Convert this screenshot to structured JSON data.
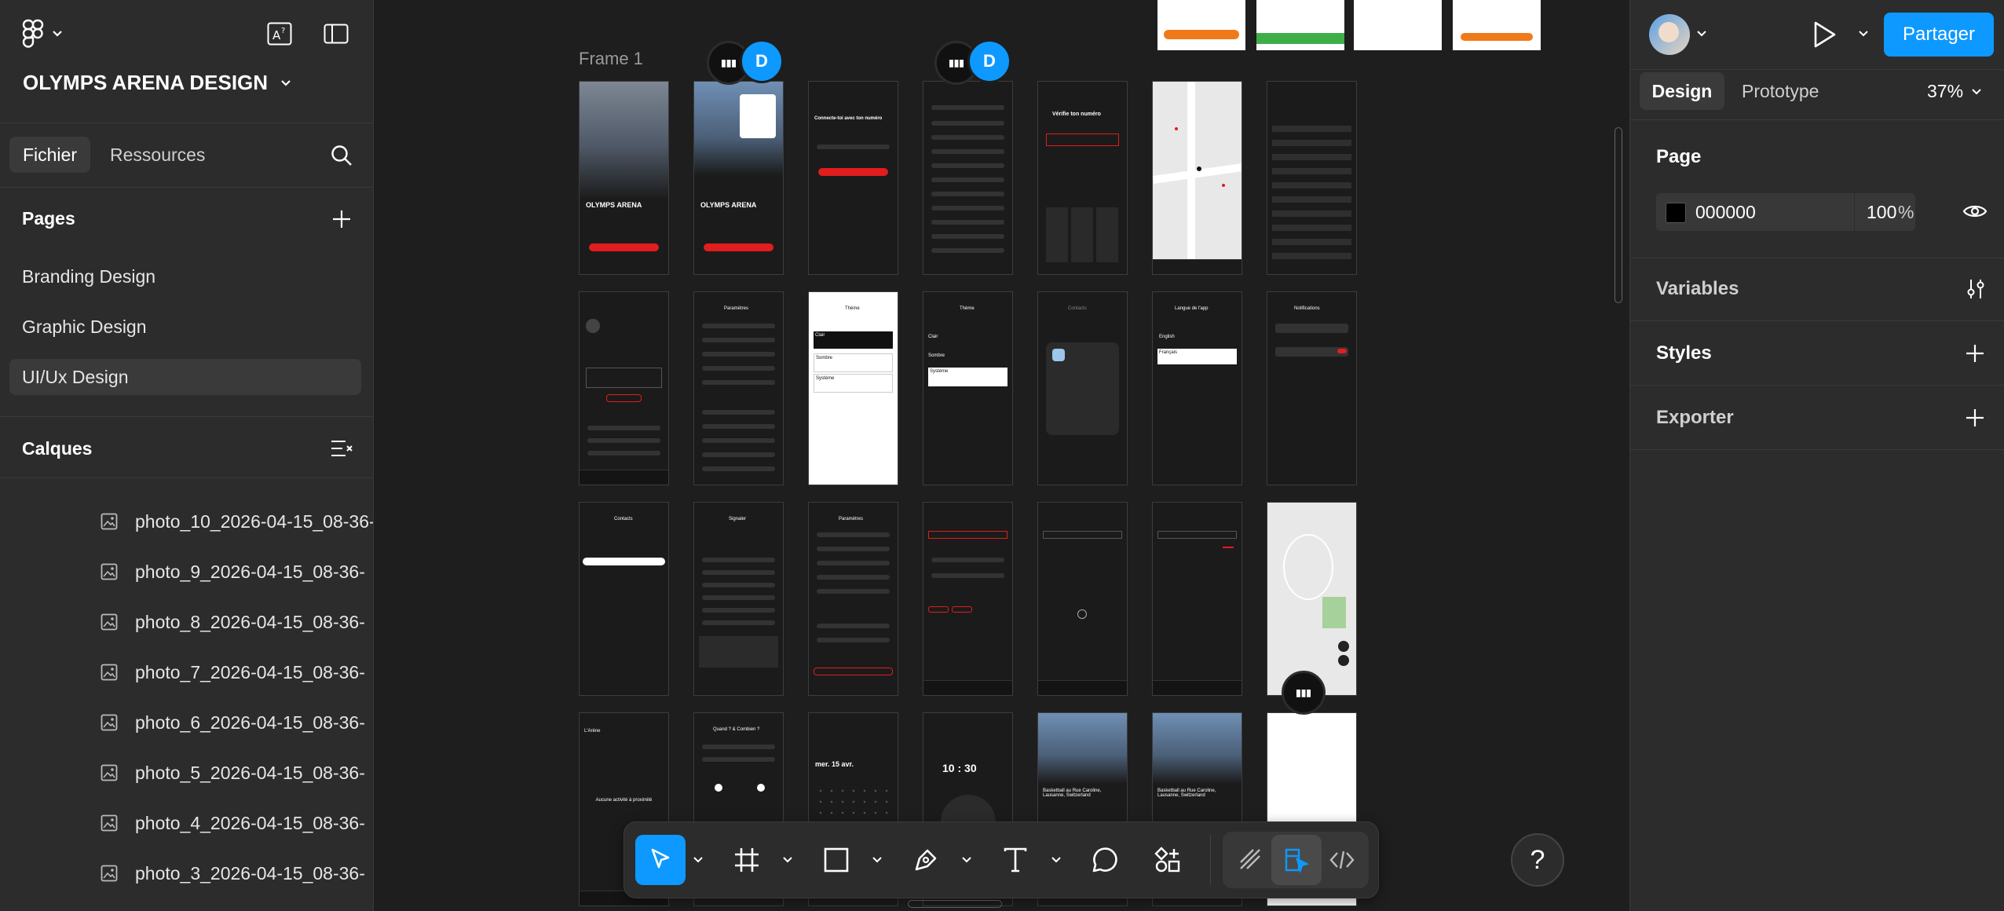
{
  "app": {
    "file_title": "OLYMPS ARENA DESIGN"
  },
  "left_panel": {
    "tabs": [
      {
        "label": "Fichier",
        "active": true
      },
      {
        "label": "Ressources",
        "active": false
      }
    ],
    "pages_title": "Pages",
    "pages": [
      {
        "label": "Branding Design",
        "active": false
      },
      {
        "label": "Graphic Design",
        "active": false
      },
      {
        "label": "UI/Ux Design",
        "active": true
      }
    ],
    "layers_title": "Calques",
    "layers": [
      "photo_10_2026-04-15_08-36-",
      "photo_9_2026-04-15_08-36-",
      "photo_8_2026-04-15_08-36-",
      "photo_7_2026-04-15_08-36-",
      "photo_6_2026-04-15_08-36-",
      "photo_5_2026-04-15_08-36-",
      "photo_4_2026-04-15_08-36-",
      "photo_3_2026-04-15_08-36-"
    ]
  },
  "canvas": {
    "frame_label": "Frame 1",
    "collaborator_initial": "D",
    "screen_texts": {
      "brand": "OLYMPS ARENA",
      "connect": "Connecte-toi avec ton numéro",
      "verify": "Vérifie ton numéro",
      "theme": "Thème",
      "parametres": "Paramètres",
      "contacts": "Contacts",
      "langue": "Langue de l'app",
      "notifications": "Notifications",
      "signaler": "Signaler",
      "activite": "L'Arène",
      "quand": "Quand ? & Combien ?",
      "date": "mer. 15 avr.",
      "time_h": "10",
      "time_m": "30",
      "basket": "Basketball au Rue Caroline, Lausanne, Switzerland",
      "no_activity": "Aucune activité à proximité",
      "clair": "Clair",
      "sombre": "Sombre",
      "systeme": "Système",
      "english": "English",
      "francais": "Français"
    }
  },
  "toolbar": {
    "tools": [
      "move",
      "frame",
      "rectangle",
      "pen",
      "text",
      "comment",
      "actions"
    ],
    "modes": [
      "draw",
      "design",
      "dev"
    ]
  },
  "right_panel": {
    "share_label": "Partager",
    "tabs": [
      {
        "label": "Design",
        "active": true
      },
      {
        "label": "Prototype",
        "active": false
      }
    ],
    "zoom": "37%",
    "page_section": "Page",
    "page_color_hex": "000000",
    "page_opacity": "100",
    "percent_sign": "%",
    "variables_section": "Variables",
    "styles_section": "Styles",
    "export_section": "Exporter"
  },
  "help_label": "?",
  "colors": {
    "accent": "#0d99ff",
    "brand_red": "#e11d1d",
    "panel_bg": "#2c2c2c",
    "canvas_bg": "#1e1e1e"
  }
}
